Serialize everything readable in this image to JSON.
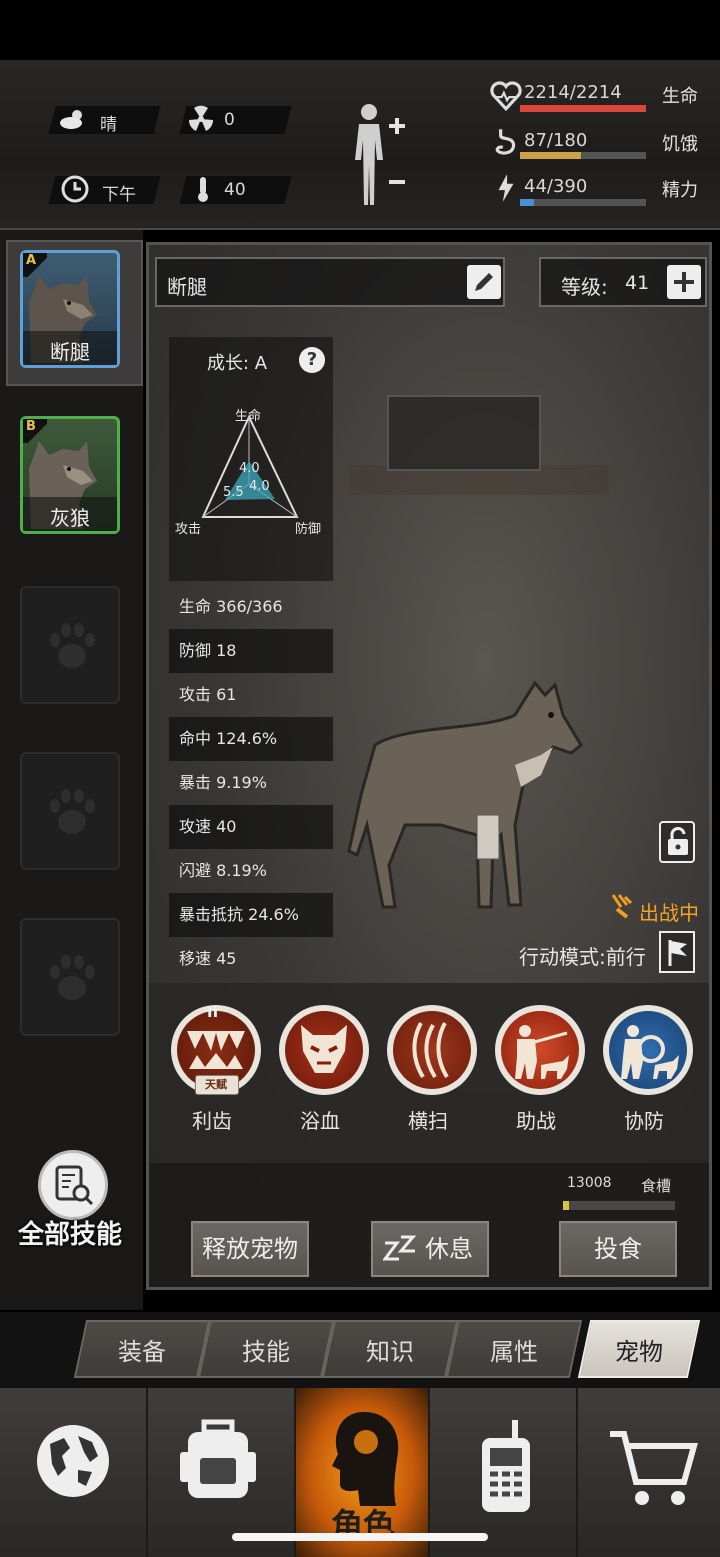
{
  "hud": {
    "weather": "晴",
    "radiation": "0",
    "time_of_day": "下午",
    "temperature": "40",
    "health": {
      "text": "2214/2214",
      "label": "生命",
      "fraction": 1.0,
      "color": "#d9483a"
    },
    "hunger": {
      "text": "87/180",
      "label": "饥饿",
      "fraction": 0.483,
      "color": "#c9a24a"
    },
    "energy": {
      "text": "44/390",
      "label": "精力",
      "fraction": 0.113,
      "color": "#4a8fd0"
    }
  },
  "sidebar": {
    "pets": [
      {
        "grade": "A",
        "name": "断腿",
        "selected": true
      },
      {
        "grade": "B",
        "name": "灰狼",
        "selected": false
      }
    ],
    "all_skills_label": "全部技能"
  },
  "pet": {
    "name": "断腿",
    "level_label": "等级: ",
    "level": "41",
    "growth": "成长: A",
    "radar": {
      "top": "生命",
      "left": "攻击",
      "right": "防御",
      "hp": "4.0",
      "atk": "5.5",
      "def": "4.0"
    },
    "stats": [
      "生命 366/366",
      "防御 18",
      "攻击 61",
      "命中 124.6%",
      "暴击 9.19%",
      "攻速 40",
      "闪避 8.19%",
      "暴击抵抗 24.6%",
      "移速 45"
    ],
    "battle_status": "出战中",
    "action_mode": "行动模式:前行"
  },
  "skills": [
    {
      "name": "利齿",
      "badge": "天赋",
      "rank": "II"
    },
    {
      "name": "浴血"
    },
    {
      "name": "横扫"
    },
    {
      "name": "助战"
    },
    {
      "name": "协防"
    }
  ],
  "food": {
    "value": "13008",
    "label": "食槽",
    "fraction": 0.05
  },
  "buttons": {
    "release": "释放宠物",
    "rest": "休息",
    "feed": "投食"
  },
  "tabs": [
    "装备",
    "技能",
    "知识",
    "属性",
    "宠物"
  ],
  "bottom_nav": {
    "active_label": "角色"
  }
}
